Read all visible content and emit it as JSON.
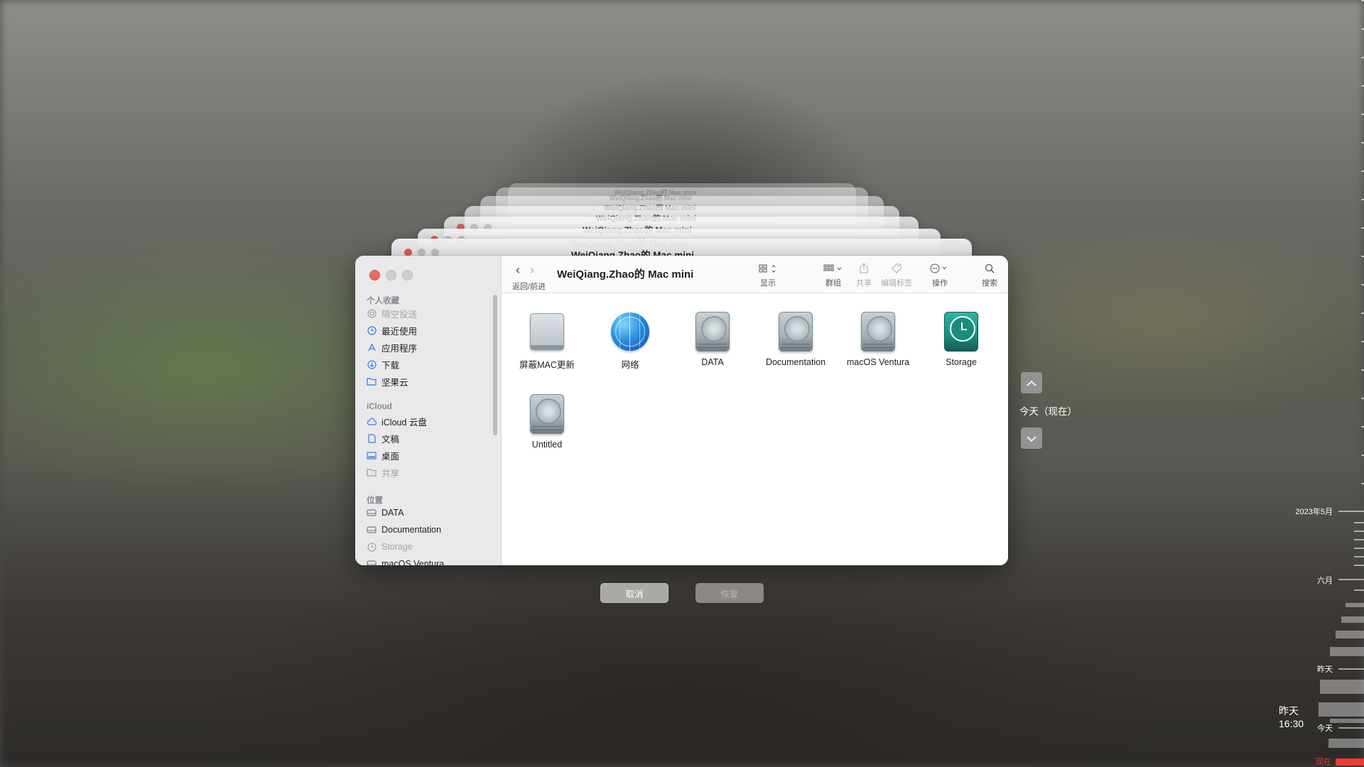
{
  "window": {
    "title": "WeiQiang.Zhao的 Mac mini",
    "ghost_title": "WeiQiang.Zhao的 Mac mini"
  },
  "toolbar": {
    "nav_label": "返回/前进",
    "view_label": "显示",
    "group_label": "群组",
    "share_label": "共享",
    "tags_label": "编辑标签",
    "action_label": "操作",
    "search_label": "搜索"
  },
  "sidebar": {
    "favorites_header": "个人收藏",
    "favorites": [
      {
        "label": "隔空投送",
        "icon": "airdrop-icon",
        "dim": true
      },
      {
        "label": "最近使用",
        "icon": "clock-icon"
      },
      {
        "label": "应用程序",
        "icon": "applications-icon"
      },
      {
        "label": "下载",
        "icon": "download-icon"
      },
      {
        "label": "坚果云",
        "icon": "folder-icon"
      }
    ],
    "icloud_header": "iCloud",
    "icloud": [
      {
        "label": "iCloud 云盘",
        "icon": "cloud-icon"
      },
      {
        "label": "文稿",
        "icon": "document-icon"
      },
      {
        "label": "桌面",
        "icon": "desktop-icon"
      },
      {
        "label": "共享",
        "icon": "shared-folder-icon",
        "dim": true
      }
    ],
    "locations_header": "位置",
    "locations": [
      {
        "label": "DATA",
        "icon": "disk-icon"
      },
      {
        "label": "Documentation",
        "icon": "disk-icon"
      },
      {
        "label": "Storage",
        "icon": "time-machine-icon",
        "dim": true
      },
      {
        "label": "macOS Ventura",
        "icon": "disk-icon"
      }
    ]
  },
  "files": [
    {
      "label": "屏蔽MAC更新",
      "icon": "external-drive-icon"
    },
    {
      "label": "网络",
      "icon": "network-globe-icon"
    },
    {
      "label": "DATA",
      "icon": "hard-disk-icon"
    },
    {
      "label": "Documentation",
      "icon": "hard-disk-icon"
    },
    {
      "label": "macOS Ventura",
      "icon": "hard-disk-icon"
    },
    {
      "label": "Storage",
      "icon": "time-machine-disk-icon"
    },
    {
      "label": "Untitled",
      "icon": "hard-disk-icon"
    }
  ],
  "buttons": {
    "cancel": "取消",
    "restore": "恢复"
  },
  "time_machine": {
    "current_label": "今天（现在）",
    "timeline_labels": {
      "month_may": "2023年5月",
      "june": "六月",
      "yesterday": "昨天",
      "yesterday_time": "昨天 16:30",
      "today": "今天",
      "now": "现在"
    },
    "now_color": "#ef3b30"
  }
}
